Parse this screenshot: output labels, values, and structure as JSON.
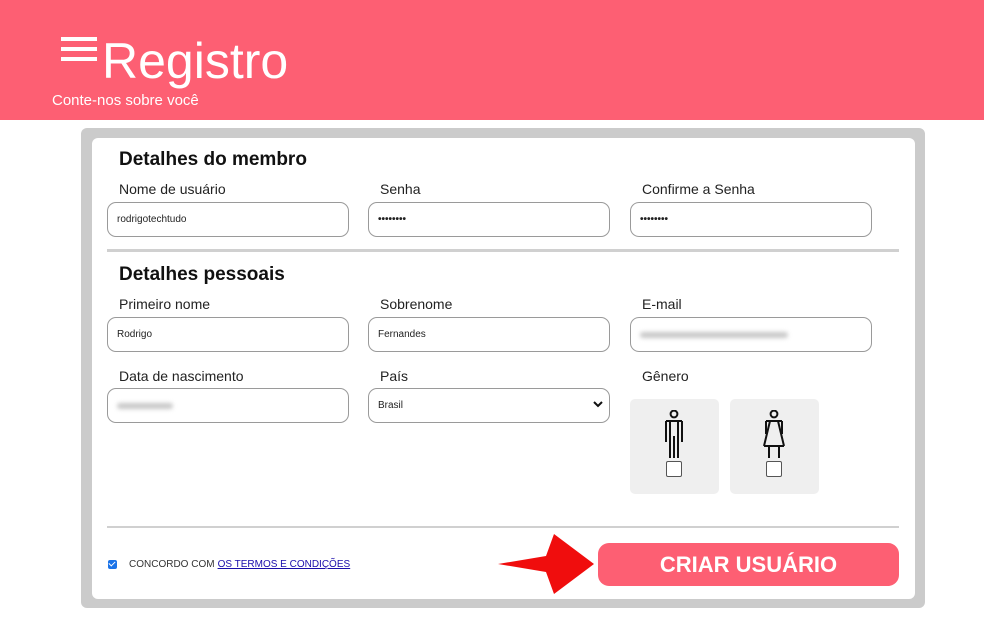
{
  "header": {
    "title": "Registro",
    "subtitle": "Conte-nos sobre você",
    "background": "#fd5f73"
  },
  "member": {
    "section_title": "Detalhes do membro",
    "username_label": "Nome de usuário",
    "username_value": "rodrigotechtudo",
    "password_label": "Senha",
    "password_value": "••••••••",
    "confirm_label": "Confirme a Senha",
    "confirm_value": "••••••••"
  },
  "personal": {
    "section_title": "Detalhes pessoais",
    "first_name_label": "Primeiro nome",
    "first_name_value": "Rodrigo",
    "last_name_label": "Sobrenome",
    "last_name_value": "Fernandes",
    "email_label": "E-mail",
    "birth_label": "Data de nascimento",
    "country_label": "País",
    "country_value": "Brasil",
    "gender_label": "Gênero",
    "gender_options": [
      "male-icon",
      "female-icon"
    ]
  },
  "footer": {
    "terms_text": "CONCORDO COM",
    "terms_link": "OS TERMOS E CONDIÇÕES",
    "terms_checked": true,
    "submit_label": "CRIAR USUÁRIO",
    "annotation": "red-arrow-icon"
  }
}
